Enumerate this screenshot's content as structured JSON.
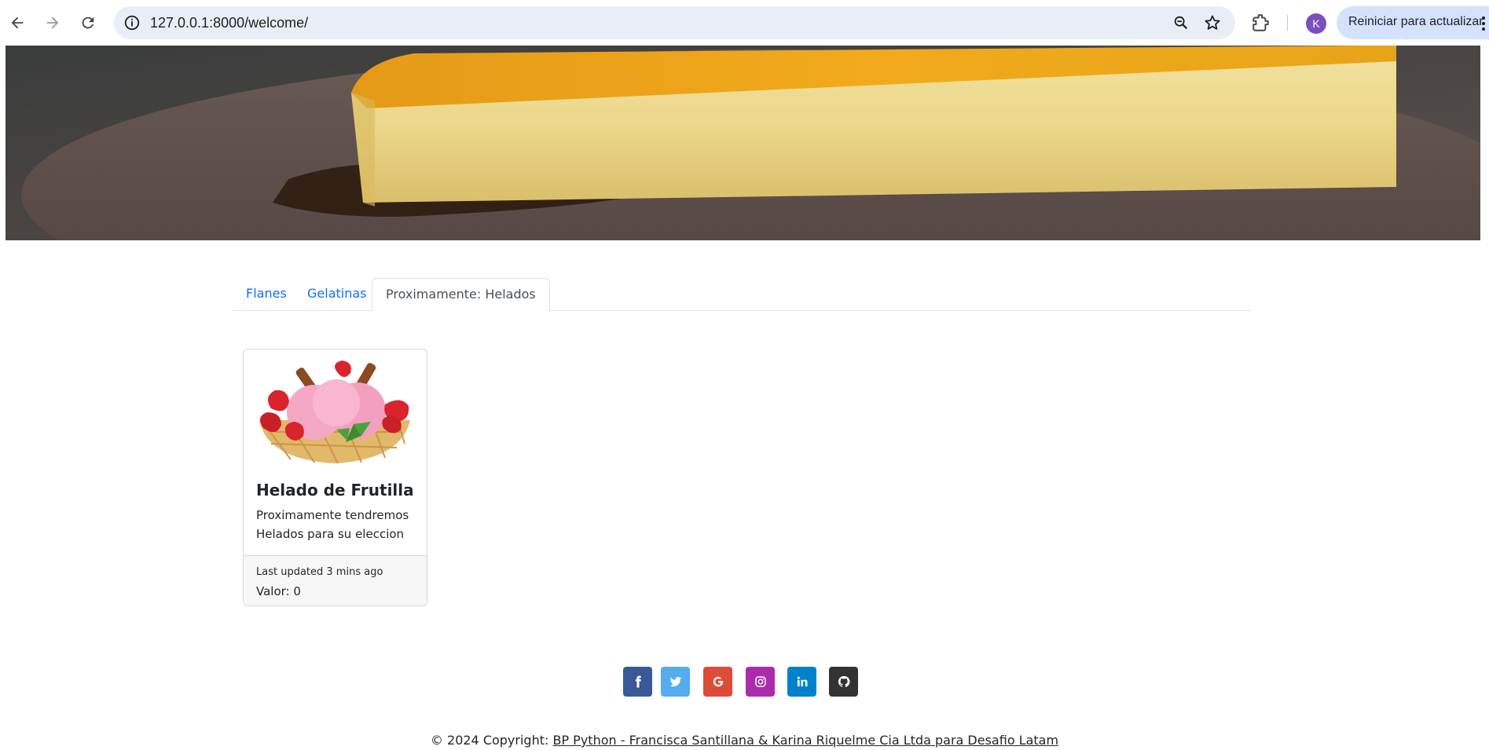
{
  "browser": {
    "url": "127.0.0.1:8000/welcome/",
    "profile_initial": "K",
    "restart_label": "Reiniciar para actualizar"
  },
  "hero": {
    "image": "flan-slice-photo"
  },
  "tabs": [
    {
      "label": "Flanes",
      "active": false
    },
    {
      "label": "Gelatinas",
      "active": false
    },
    {
      "label": "Proximamente: Helados",
      "active": true
    }
  ],
  "card": {
    "image": "strawberry-ice-cream-photo",
    "title": "Helado de Frutilla",
    "text": "Proximamente tendremos Helados para su eleccion",
    "updated": "Last updated 3 mins ago",
    "valor": "Valor: 0"
  },
  "social": [
    {
      "icon": "facebook-icon",
      "color": "#3b5998"
    },
    {
      "icon": "twitter-icon",
      "color": "#55acee"
    },
    {
      "icon": "google-icon",
      "color": "#dd4b39"
    },
    {
      "icon": "instagram-icon",
      "color": "#ac2bac"
    },
    {
      "icon": "linkedin-icon",
      "color": "#0082ca"
    },
    {
      "icon": "github-icon",
      "color": "#333333"
    }
  ],
  "footer": {
    "prefix": "© 2024 Copyright: ",
    "link": "BP Python - Francisca Santillana & Karina Riquelme Cia Ltda para Desafio Latam"
  }
}
